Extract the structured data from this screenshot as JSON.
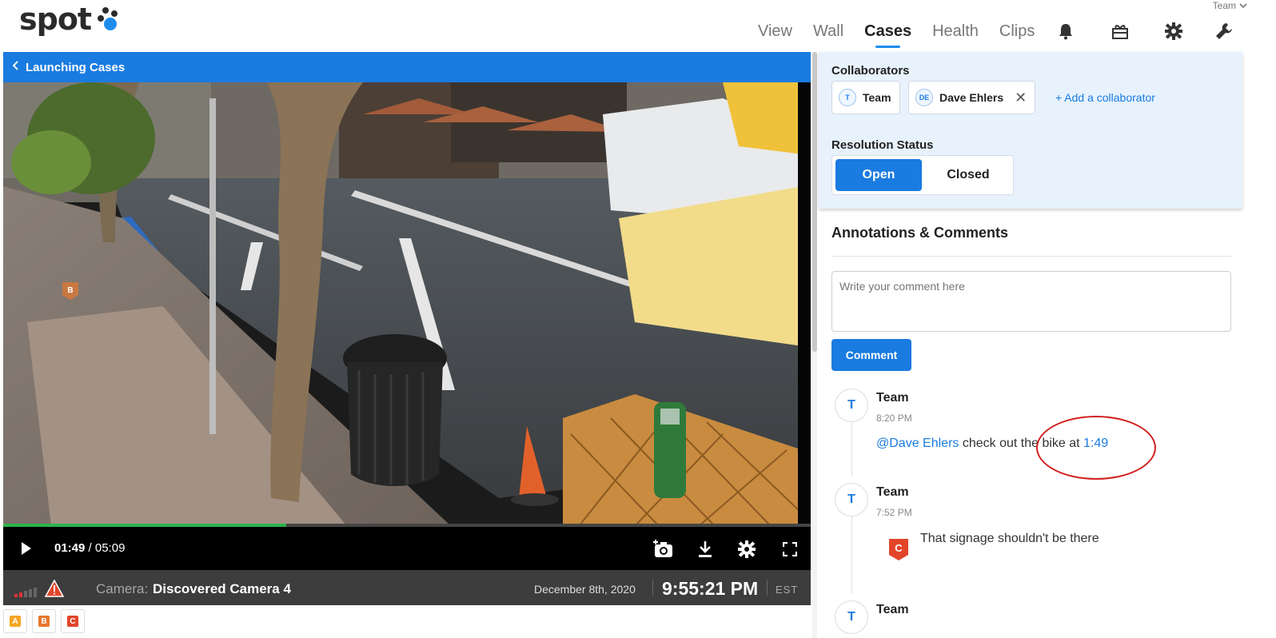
{
  "header": {
    "logo": "spot",
    "team_menu": "Team",
    "nav": [
      "View",
      "Wall",
      "Cases",
      "Health",
      "Clips"
    ],
    "active_nav": "Cases",
    "icons": [
      "bell-icon",
      "gift-icon",
      "gear-icon",
      "wrench-icon"
    ]
  },
  "case": {
    "back_label": "Launching Cases"
  },
  "player": {
    "current_time": "01:49",
    "duration": "/ 05:09",
    "progress_fraction": 0.35,
    "controls": [
      "snapshot-icon",
      "download-icon",
      "settings-icon",
      "fullscreen-icon"
    ],
    "camera_label": "Camera:",
    "camera_name": "Discovered Camera 4",
    "date": "December 8th, 2020",
    "time": "9:55:21 PM",
    "timezone": "EST",
    "markers": [
      {
        "label": "A",
        "color": "#f5a623"
      },
      {
        "label": "B",
        "color": "#e8772e"
      },
      {
        "label": "C",
        "color": "#e2452a"
      }
    ],
    "video_marker": "B"
  },
  "collaborators": {
    "title": "Collaborators",
    "people": [
      {
        "initials": "T",
        "name": "Team",
        "removable": false
      },
      {
        "initials": "DE",
        "name": "Dave Ehlers",
        "removable": true
      }
    ],
    "add_label": "+ Add a collaborator"
  },
  "resolution": {
    "title": "Resolution Status",
    "options": [
      "Open",
      "Closed"
    ],
    "selected": "Open"
  },
  "annotations": {
    "title": "Annotations & Comments",
    "placeholder": "Write your comment here",
    "button_label": "Comment",
    "comments": [
      {
        "initials": "T",
        "author": "Team",
        "time": "8:20 PM",
        "mention": "@Dave Ehlers",
        "text": " check out the bike at ",
        "timestamp": "1:49"
      },
      {
        "initials": "T",
        "author": "Team",
        "time": "7:52 PM",
        "marker": "C",
        "text": "That signage shouldn't be there"
      },
      {
        "initials": "T",
        "author": "Team"
      }
    ]
  },
  "colors": {
    "accent": "#1a7be0",
    "progress": "#2bb34b",
    "alert": "#e2452a",
    "panel_bg": "#e7f2fd"
  }
}
